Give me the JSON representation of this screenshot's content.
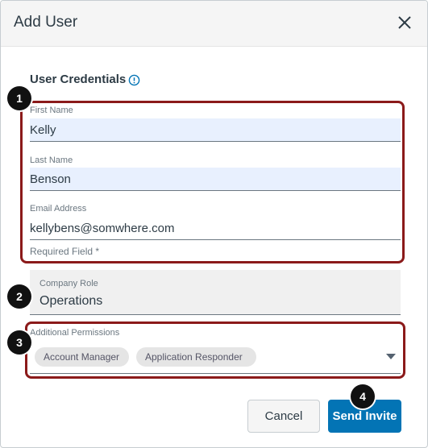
{
  "dialog": {
    "title": "Add User",
    "close_icon": "close-icon"
  },
  "credentials": {
    "section_title": "User Credentials",
    "info_icon": "info-icon",
    "first_name": {
      "label": "First Name",
      "value": "Kelly"
    },
    "last_name": {
      "label": "Last Name",
      "value": "Benson"
    },
    "email": {
      "label": "Email Address",
      "value": "kellybens@somwhere.com"
    },
    "required_note": "Required Field *"
  },
  "company_role": {
    "label": "Company Role",
    "value": "Operations"
  },
  "permissions": {
    "label": "Additional Permissions",
    "chips": [
      "Account Manager",
      "Application Responder"
    ],
    "dropdown_icon": "caret-down-icon"
  },
  "actions": {
    "cancel": "Cancel",
    "send_invite": "Send Invite"
  },
  "step_markers": [
    "1",
    "2",
    "3",
    "4"
  ],
  "colors": {
    "annotation_border": "#8b1a1a",
    "primary_button": "#0374b5",
    "autofill_background": "#e8f0fe",
    "step_marker": "#111111"
  }
}
